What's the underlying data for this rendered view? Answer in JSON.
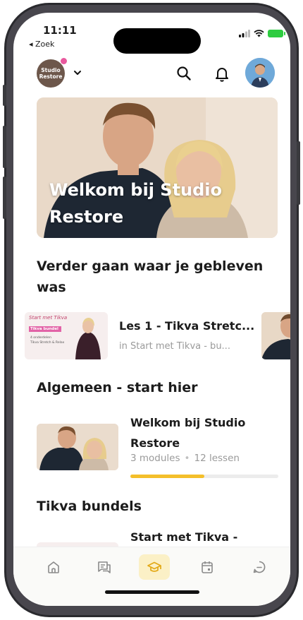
{
  "status_bar": {
    "time": "11:11",
    "back_app": "◂ Zoek"
  },
  "header": {
    "logo_text_line1": "Studio",
    "logo_text_line2": "Restore",
    "accent": "#f4bf2a"
  },
  "hero": {
    "title": "Welkom bij Studio Restore"
  },
  "continue": {
    "heading": "Verder gaan waar je gebleven was",
    "item": {
      "title": "Les 1 - Tikva Stretc...",
      "subtitle": "in Start met Tikva - bu...",
      "thumb_script": "Start met Tikva",
      "thumb_label": "Tikva bundel",
      "thumb_sub1": "4 onderdelen",
      "thumb_sub2": "Tikva Stretch & Relax"
    }
  },
  "algemeen": {
    "heading": "Algemeen - start hier",
    "course": {
      "title": "Welkom bij Studio Restore",
      "modules": "3 modules",
      "lessons": "12 lessen",
      "progress": 0.5
    }
  },
  "bundles": {
    "heading": "Tikva bundels",
    "course": {
      "title": "Start met Tikva -"
    }
  },
  "tabbar": {
    "items": [
      {
        "name": "home-icon"
      },
      {
        "name": "feed-icon"
      },
      {
        "name": "courses-icon",
        "active": true
      },
      {
        "name": "calendar-icon"
      },
      {
        "name": "chat-icon"
      }
    ]
  }
}
